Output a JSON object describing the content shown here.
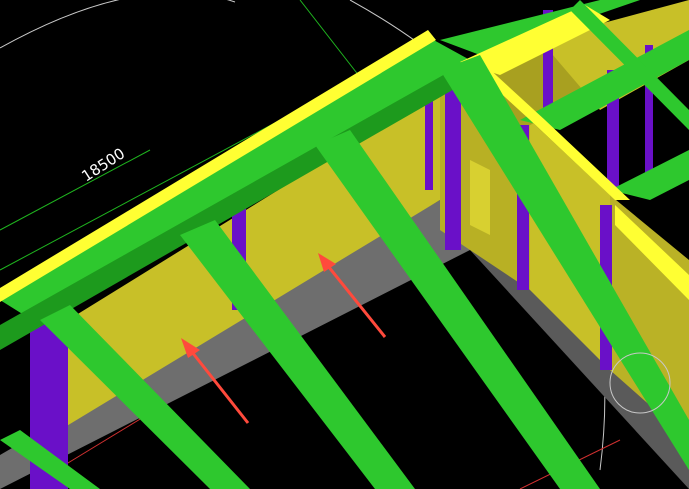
{
  "viewport": {
    "background": "#000000",
    "dimension_label": "18500"
  },
  "colors": {
    "beam": "#2ec82e",
    "beam_dark": "#1d9a1d",
    "beam_top": "#ffff33",
    "wall": "#c8c028",
    "wall_dark": "#a8a020",
    "slab": "#6e6e6e",
    "slab_dark": "#4e4e4e",
    "column": "#6a10c8",
    "column_dark": "#4a0a9a",
    "arrow": "#ff4a3c",
    "guide_green": "#1fb41f",
    "guide_white": "#c8c8c8",
    "guide_red": "#d03030"
  },
  "annotations": {
    "arrows": [
      "left-arrow",
      "right-arrow"
    ]
  }
}
